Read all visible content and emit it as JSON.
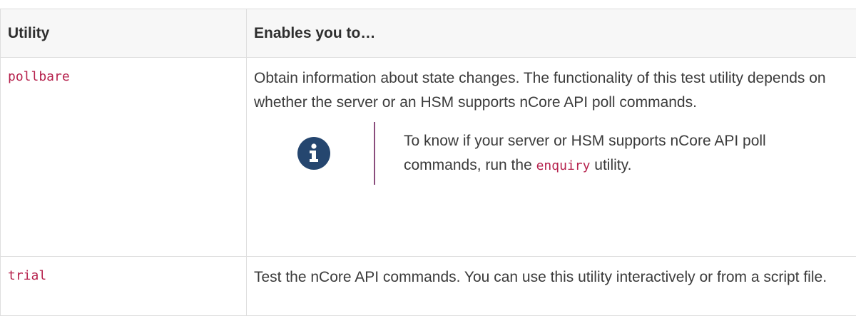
{
  "table": {
    "headers": [
      "Utility",
      "Enables you to…"
    ],
    "rows": [
      {
        "utility": "pollbare",
        "description": "Obtain information about state changes. The functionality of this test utility depends on whether the server or an HSM supports nCore API poll commands.",
        "note": {
          "icon": "info-icon",
          "text_before": "To know if your server or HSM supports nCore API poll commands, run the ",
          "code": "enquiry",
          "text_after": " utility."
        }
      },
      {
        "utility": "trial",
        "description": "Test the nCore API commands. You can use this utility interactively or from a script file."
      }
    ]
  },
  "colors": {
    "code": "#b6224d",
    "info_icon_bg": "#25466f",
    "note_divider": "#8a4d7d",
    "header_bg": "#f7f7f7",
    "border": "#dedede"
  }
}
